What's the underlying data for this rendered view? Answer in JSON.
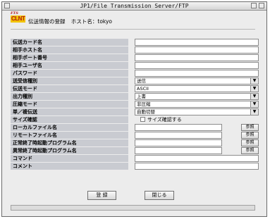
{
  "window": {
    "title": "JP1/File Transmission Server/FTP"
  },
  "logo": {
    "top": "FTS",
    "main": "CLNT"
  },
  "header": {
    "label": "伝送情報の登録",
    "host_label": "ホスト名：tokyo"
  },
  "form": {
    "card_name": "伝送カード名",
    "remote_host": "相手ホスト名",
    "remote_port": "相手ポート番号",
    "remote_user": "相手ユーザ名",
    "password": "パスワード",
    "send_recv_type": {
      "label": "送受信種別",
      "value": "送信"
    },
    "transfer_mode": {
      "label": "伝送モード",
      "value": "ASCII"
    },
    "output_type": {
      "label": "出力種別",
      "value": "上書"
    },
    "compress_mode": {
      "label": "圧縮モード",
      "value": "非圧縮"
    },
    "single_multi": {
      "label": "単／複伝送",
      "value": "自動切替"
    },
    "size_confirm": {
      "label": "サイズ確認",
      "checkbox_label": "サイズ確認する",
      "checked": false
    },
    "local_file": "ローカルファイル名",
    "remote_file": "リモートファイル名",
    "normal_end_program": "正常終了時起動プログラム名",
    "abnormal_end_program": "異常終了時起動プログラム名",
    "command": "コマンド",
    "comment": "コメント",
    "browse_label": "参照"
  },
  "buttons": {
    "register": "登 録",
    "close": "閉じる"
  }
}
